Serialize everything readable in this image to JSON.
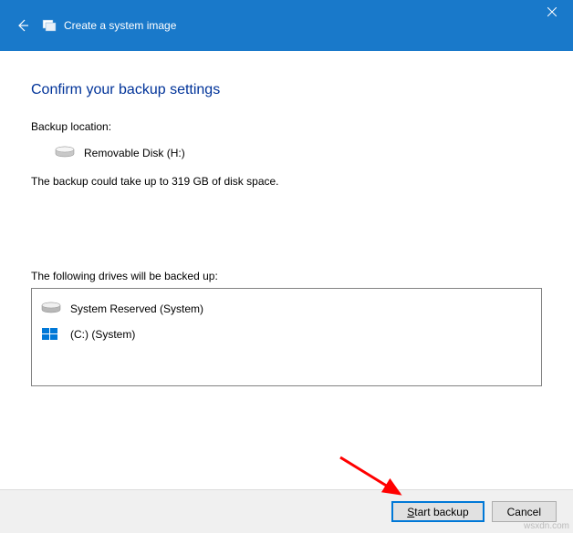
{
  "titlebar": {
    "title": "Create a system image"
  },
  "content": {
    "heading": "Confirm your backup settings",
    "location_label": "Backup location:",
    "location_value": "Removable Disk (H:)",
    "size_estimate": "The backup could take up to 319 GB of disk space.",
    "drives_label": "The following drives will be backed up:",
    "drives": [
      {
        "name": "System Reserved (System)",
        "icon": "hdd"
      },
      {
        "name": "(C:) (System)",
        "icon": "windows"
      }
    ]
  },
  "footer": {
    "start_label_u": "S",
    "start_label_rest": "tart backup",
    "cancel_label": "Cancel"
  },
  "watermark": "wsxdn.com"
}
